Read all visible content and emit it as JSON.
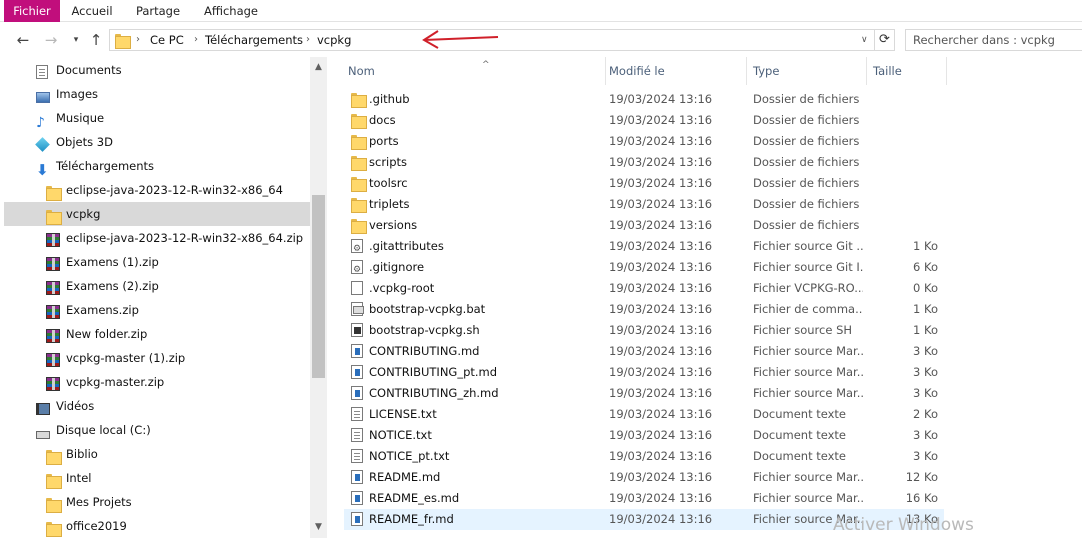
{
  "ribbon": {
    "tabs": [
      "Fichier",
      "Accueil",
      "Partage",
      "Affichage"
    ]
  },
  "address": {
    "crumbs": [
      "Ce PC",
      "Téléchargements",
      "vcpkg"
    ],
    "search_placeholder": "Rechercher dans : vcpkg"
  },
  "nav": {
    "items": [
      {
        "label": "Documents",
        "icon": "documents-icon"
      },
      {
        "label": "Images",
        "icon": "images-icon"
      },
      {
        "label": "Musique",
        "icon": "music-icon"
      },
      {
        "label": "Objets 3D",
        "icon": "3d-objects-icon"
      },
      {
        "label": "Téléchargements",
        "icon": "downloads-icon"
      },
      {
        "label": "eclipse-java-2023-12-R-win32-x86_64",
        "icon": "folder-icon"
      },
      {
        "label": "vcpkg",
        "icon": "folder-icon",
        "selected": true
      },
      {
        "label": "eclipse-java-2023-12-R-win32-x86_64.zip",
        "icon": "zip-icon"
      },
      {
        "label": "Examens (1).zip",
        "icon": "zip-icon"
      },
      {
        "label": "Examens (2).zip",
        "icon": "zip-icon"
      },
      {
        "label": "Examens.zip",
        "icon": "zip-icon"
      },
      {
        "label": "New folder.zip",
        "icon": "zip-icon"
      },
      {
        "label": "vcpkg-master (1).zip",
        "icon": "zip-icon"
      },
      {
        "label": "vcpkg-master.zip",
        "icon": "zip-icon"
      },
      {
        "label": "Vidéos",
        "icon": "videos-icon"
      },
      {
        "label": "Disque local (C:)",
        "icon": "drive-icon"
      },
      {
        "label": "Biblio",
        "icon": "folder-icon"
      },
      {
        "label": "Intel",
        "icon": "folder-icon"
      },
      {
        "label": "Mes Projets",
        "icon": "project-folder-icon"
      },
      {
        "label": "office2019",
        "icon": "folder-icon"
      }
    ]
  },
  "columns": {
    "name": "Nom",
    "modified": "Modifié le",
    "type": "Type",
    "size": "Taille"
  },
  "files": [
    {
      "name": ".github",
      "date": "19/03/2024 13:16",
      "type": "Dossier de fichiers",
      "size": "",
      "icon": "folder"
    },
    {
      "name": "docs",
      "date": "19/03/2024 13:16",
      "type": "Dossier de fichiers",
      "size": "",
      "icon": "folder"
    },
    {
      "name": "ports",
      "date": "19/03/2024 13:16",
      "type": "Dossier de fichiers",
      "size": "",
      "icon": "folder"
    },
    {
      "name": "scripts",
      "date": "19/03/2024 13:16",
      "type": "Dossier de fichiers",
      "size": "",
      "icon": "folder"
    },
    {
      "name": "toolsrc",
      "date": "19/03/2024 13:16",
      "type": "Dossier de fichiers",
      "size": "",
      "icon": "folder"
    },
    {
      "name": "triplets",
      "date": "19/03/2024 13:16",
      "type": "Dossier de fichiers",
      "size": "",
      "icon": "folder"
    },
    {
      "name": "versions",
      "date": "19/03/2024 13:16",
      "type": "Dossier de fichiers",
      "size": "",
      "icon": "folder"
    },
    {
      "name": ".gitattributes",
      "date": "19/03/2024 13:16",
      "type": "Fichier source Git ...",
      "size": "1 Ko",
      "icon": "gear"
    },
    {
      "name": ".gitignore",
      "date": "19/03/2024 13:16",
      "type": "Fichier source Git I...",
      "size": "6 Ko",
      "icon": "gear"
    },
    {
      "name": ".vcpkg-root",
      "date": "19/03/2024 13:16",
      "type": "Fichier VCPKG-RO...",
      "size": "0 Ko",
      "icon": "blank"
    },
    {
      "name": "bootstrap-vcpkg.bat",
      "date": "19/03/2024 13:16",
      "type": "Fichier de comma...",
      "size": "1 Ko",
      "icon": "bat"
    },
    {
      "name": "bootstrap-vcpkg.sh",
      "date": "19/03/2024 13:16",
      "type": "Fichier source SH",
      "size": "1 Ko",
      "icon": "sh"
    },
    {
      "name": "CONTRIBUTING.md",
      "date": "19/03/2024 13:16",
      "type": "Fichier source Mar...",
      "size": "3 Ko",
      "icon": "md"
    },
    {
      "name": "CONTRIBUTING_pt.md",
      "date": "19/03/2024 13:16",
      "type": "Fichier source Mar...",
      "size": "3 Ko",
      "icon": "md"
    },
    {
      "name": "CONTRIBUTING_zh.md",
      "date": "19/03/2024 13:16",
      "type": "Fichier source Mar...",
      "size": "3 Ko",
      "icon": "md"
    },
    {
      "name": "LICENSE.txt",
      "date": "19/03/2024 13:16",
      "type": "Document texte",
      "size": "2 Ko",
      "icon": "txt"
    },
    {
      "name": "NOTICE.txt",
      "date": "19/03/2024 13:16",
      "type": "Document texte",
      "size": "3 Ko",
      "icon": "txt"
    },
    {
      "name": "NOTICE_pt.txt",
      "date": "19/03/2024 13:16",
      "type": "Document texte",
      "size": "3 Ko",
      "icon": "txt"
    },
    {
      "name": "README.md",
      "date": "19/03/2024 13:16",
      "type": "Fichier source Mar...",
      "size": "12 Ko",
      "icon": "md"
    },
    {
      "name": "README_es.md",
      "date": "19/03/2024 13:16",
      "type": "Fichier source Mar...",
      "size": "16 Ko",
      "icon": "md"
    },
    {
      "name": "README_fr.md",
      "date": "19/03/2024 13:16",
      "type": "Fichier source Mar...",
      "size": "13 Ko",
      "icon": "md",
      "highlight": true
    }
  ],
  "watermark": "Activer Windows",
  "colors": {
    "file_tab": "#c10e7c",
    "selected_row": "#d9d9d9",
    "hover_row": "#e5f3ff",
    "arrow": "#d0202a"
  }
}
